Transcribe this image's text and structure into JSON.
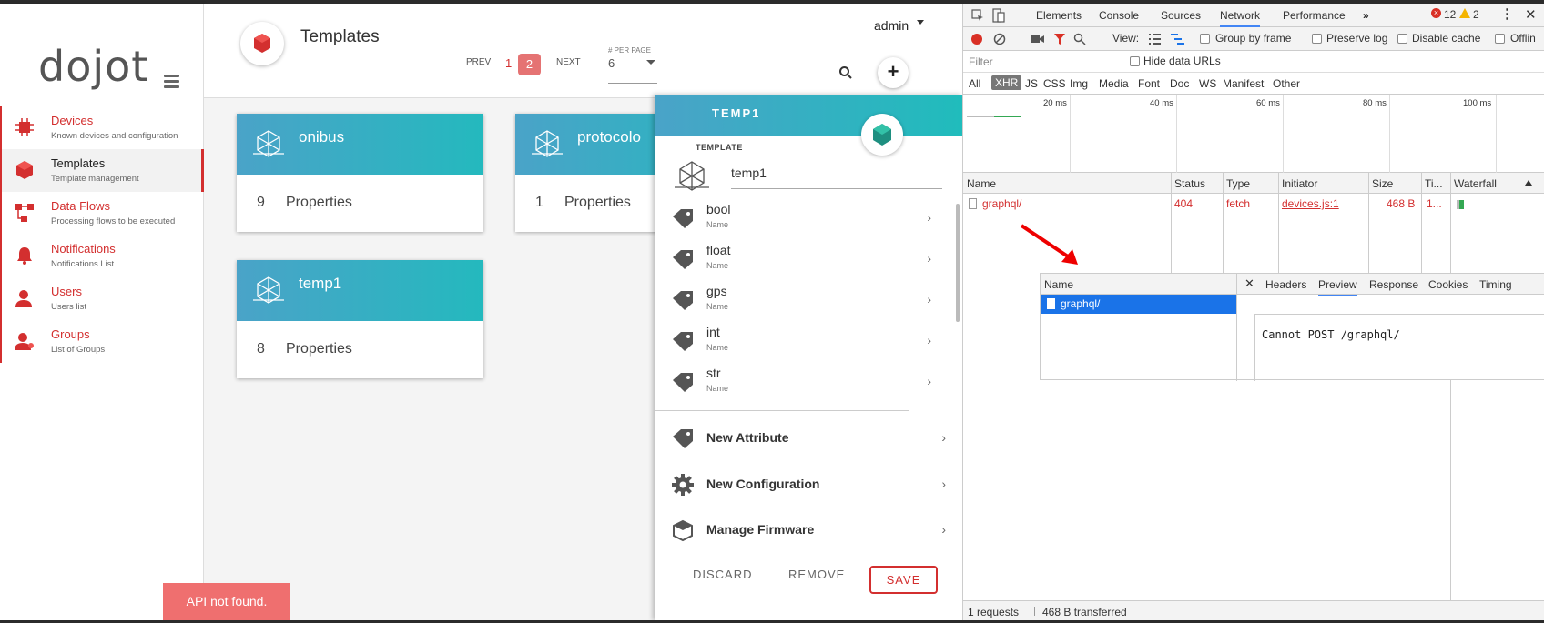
{
  "app": {
    "logo": "dojot",
    "toast": "API not found."
  },
  "sidebar": {
    "items": [
      {
        "title": "Devices",
        "subtitle": "Known devices and configuration"
      },
      {
        "title": "Templates",
        "subtitle": "Template management"
      },
      {
        "title": "Data Flows",
        "subtitle": "Processing flows to be executed"
      },
      {
        "title": "Notifications",
        "subtitle": "Notifications List"
      },
      {
        "title": "Users",
        "subtitle": "Users list"
      },
      {
        "title": "Groups",
        "subtitle": "List of Groups"
      }
    ]
  },
  "header": {
    "title": "Templates",
    "user": "admin",
    "pagination": {
      "prev": "PREV",
      "page1": "1",
      "page2": "2",
      "next": "NEXT"
    },
    "per_page": {
      "label": "# PER PAGE",
      "value": "6"
    },
    "add": "+"
  },
  "cards": [
    {
      "name": "onibus",
      "count": "9",
      "label": "Properties"
    },
    {
      "name": "protocolo",
      "count": "1",
      "label": "Properties"
    },
    {
      "name": "temp1",
      "count": "8",
      "label": "Properties"
    }
  ],
  "panel": {
    "title": "TEMP1",
    "section_label": "TEMPLATE",
    "name_value": "temp1",
    "attributes": [
      {
        "name": "bool",
        "sub": "Name"
      },
      {
        "name": "float",
        "sub": "Name"
      },
      {
        "name": "gps",
        "sub": "Name"
      },
      {
        "name": "int",
        "sub": "Name"
      },
      {
        "name": "str",
        "sub": "Name"
      }
    ],
    "actions": [
      "New Attribute",
      "New Configuration",
      "Manage Firmware"
    ],
    "buttons": {
      "discard": "DISCARD",
      "remove": "REMOVE",
      "save": "SAVE"
    }
  },
  "devtools": {
    "tabs": [
      "Elements",
      "Console",
      "Sources",
      "Network",
      "Performance",
      "»"
    ],
    "errors": "12",
    "warnings": "2",
    "toolbar": {
      "view": "View:",
      "group_by_frame": "Group by frame",
      "preserve_log": "Preserve log",
      "disable_cache": "Disable cache",
      "offline": "Offlin"
    },
    "filter_placeholder": "Filter",
    "hide_data_urls": "Hide data URLs",
    "types": [
      "All",
      "XHR",
      "JS",
      "CSS",
      "Img",
      "Media",
      "Font",
      "Doc",
      "WS",
      "Manifest",
      "Other"
    ],
    "timeline": [
      "20 ms",
      "40 ms",
      "60 ms",
      "80 ms",
      "100 ms"
    ],
    "columns": [
      "Name",
      "Status",
      "Type",
      "Initiator",
      "Size",
      "Ti...",
      "Waterfall"
    ],
    "request": {
      "name": "graphql/",
      "status": "404",
      "type": "fetch",
      "initiator": "devices.js:1",
      "size": "468 B",
      "time": "1..."
    },
    "detail": {
      "name_header": "Name",
      "tabs": [
        "Headers",
        "Preview",
        "Response",
        "Cookies",
        "Timing"
      ],
      "selected": "graphql/",
      "preview_text": "Cannot POST /graphql/"
    },
    "footer": {
      "requests": "1 requests",
      "transferred": "468 B transferred"
    }
  },
  "colors": {
    "accent": "#d32f2f",
    "card_header": "#2bb5c0",
    "toast": "#ef6f6f",
    "selected_row": "#1a73e8"
  }
}
